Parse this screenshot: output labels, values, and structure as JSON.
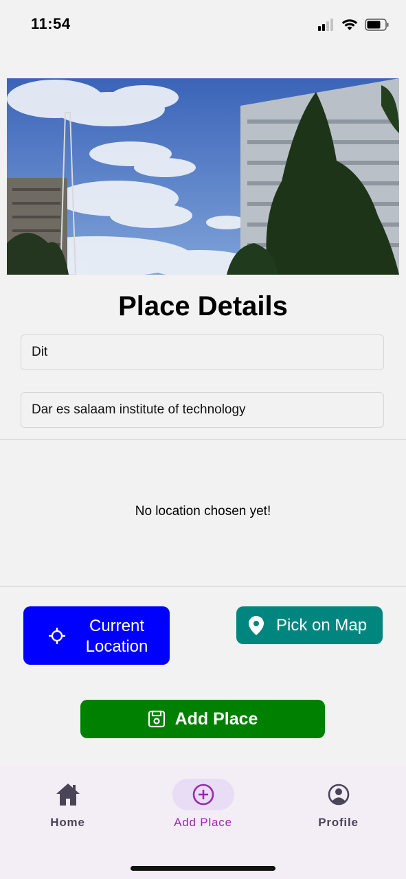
{
  "status_bar": {
    "time": "11:54"
  },
  "page": {
    "title": "Place Details"
  },
  "form": {
    "name_value": "Dit",
    "description_value": "Dar es salaam institute of technology"
  },
  "location": {
    "message": "No location chosen yet!"
  },
  "buttons": {
    "current_location": "Current\nLocation",
    "pick_on_map": "Pick on Map",
    "add_place": "Add Place"
  },
  "bottom_nav": {
    "items": [
      {
        "label": "Home",
        "icon": "home-icon"
      },
      {
        "label": "Add Place",
        "icon": "add-circle-icon",
        "active": true
      },
      {
        "label": "Profile",
        "icon": "account-circle-icon"
      }
    ]
  },
  "colors": {
    "current_location_button": "#0000ff",
    "pick_on_map_button": "#00857f",
    "add_place_button": "#008000",
    "nav_active": "#9c27b0"
  }
}
